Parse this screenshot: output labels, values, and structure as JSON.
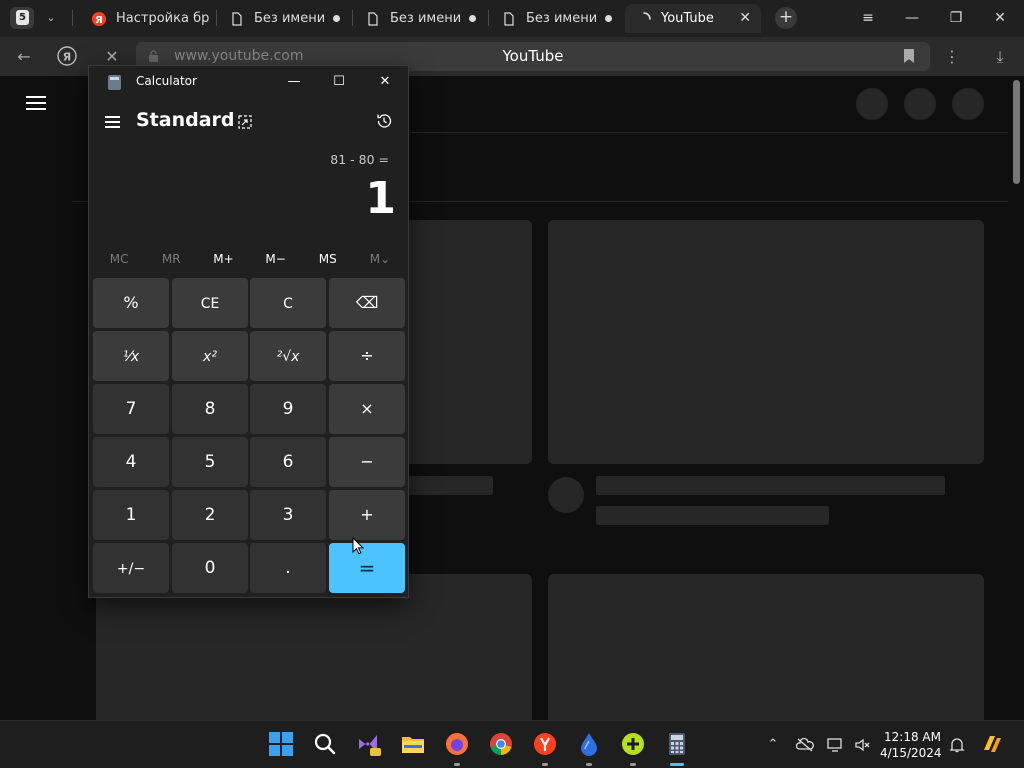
{
  "browser": {
    "tab_count": "5",
    "tabs": [
      {
        "label": "Настройка бра"
      },
      {
        "label": "Без имени"
      },
      {
        "label": "Без имени"
      },
      {
        "label": "Без имени"
      },
      {
        "label": "YouTube"
      }
    ],
    "url": "www.youtube.com",
    "page_title": "YouTube"
  },
  "calculator": {
    "window_title": "Calculator",
    "mode": "Standard",
    "expression": "81 - 80 =",
    "result": "1",
    "memory_buttons": [
      "MC",
      "MR",
      "M+",
      "M−",
      "MS",
      "M⌄"
    ],
    "keys": [
      [
        "%",
        "CE",
        "C",
        "⌫"
      ],
      [
        "¹⁄x",
        "x²",
        "²√x",
        "÷"
      ],
      [
        "7",
        "8",
        "9",
        "×"
      ],
      [
        "4",
        "5",
        "6",
        "−"
      ],
      [
        "1",
        "2",
        "3",
        "+"
      ],
      [
        "+/−",
        "0",
        ".",
        "="
      ]
    ],
    "accent_color": "#4cc2ff"
  },
  "taskbar": {
    "time": "12:18 AM",
    "date": "4/15/2024",
    "apps": [
      "start-icon",
      "search-icon",
      "visual-studio-icon",
      "file-explorer-icon",
      "firefox-icon",
      "chrome-icon",
      "yandex-browser-icon",
      "blue-drop-icon",
      "plus-app-icon",
      "calculator-icon"
    ]
  }
}
